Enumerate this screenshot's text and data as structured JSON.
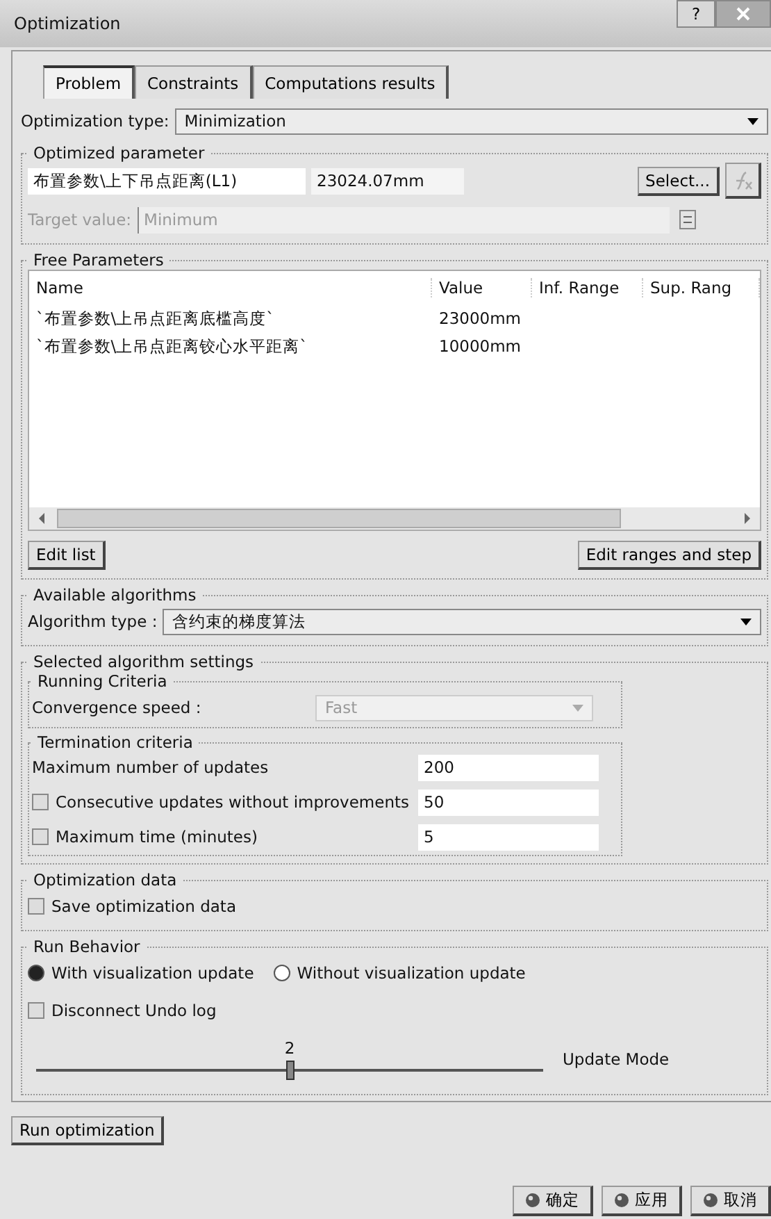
{
  "window": {
    "title": "Optimization",
    "help": "?"
  },
  "tabs": [
    {
      "label": "Problem",
      "selected": true
    },
    {
      "label": "Constraints",
      "selected": false
    },
    {
      "label": "Computations results",
      "selected": false
    }
  ],
  "optimization_type": {
    "label": "Optimization type:",
    "value": "Minimization"
  },
  "optimized_parameter": {
    "title": "Optimized parameter",
    "name": "布置参数\\上下吊点距离(L1)",
    "value": "23024.07mm",
    "select_button": "Select...",
    "target_label": "Target value:",
    "target_value": "Minimum",
    "disabled": true
  },
  "free_parameters": {
    "title": "Free Parameters",
    "columns": [
      "Name",
      "Value",
      "Inf. Range",
      "Sup. Rang"
    ],
    "rows": [
      {
        "name": "`布置参数\\上吊点距离底槛高度`",
        "value": "23000mm"
      },
      {
        "name": "`布置参数\\上吊点距离铰心水平距离`",
        "value": "10000mm"
      }
    ],
    "buttons": [
      "Edit list",
      "Edit ranges and step"
    ]
  },
  "available_algorithms": {
    "title": "Available algorithms",
    "label": "Algorithm type :",
    "value": "含约束的梯度算法"
  },
  "algorithm_settings": {
    "title": "Selected algorithm settings",
    "running_criteria": {
      "title": "Running Criteria",
      "label": "Convergence speed :",
      "value": "Fast",
      "disabled": true
    },
    "termination": {
      "title": "Termination criteria",
      "rows": [
        {
          "kind": "field",
          "label": "Maximum number of updates",
          "value": "200"
        },
        {
          "kind": "checkbox",
          "label": "Consecutive updates without improvements",
          "value": "50",
          "checked": false
        },
        {
          "kind": "checkbox",
          "label": "Maximum time (minutes)",
          "value": "5",
          "checked": false
        }
      ]
    }
  },
  "optimization_data": {
    "title": "Optimization data",
    "label": "Save optimization data",
    "checked": false
  },
  "run_behavior": {
    "title": "Run Behavior",
    "radios": [
      {
        "label": "With visualization update",
        "selected": true
      },
      {
        "label": "Without visualization update",
        "selected": false
      }
    ],
    "undo": {
      "label": "Disconnect Undo log",
      "checked": false
    },
    "slider": {
      "reading": "2",
      "level": 0.5,
      "label": "Update Mode"
    }
  },
  "run_button": "Run optimization",
  "footer_buttons": [
    "确定",
    "应用",
    "取消"
  ]
}
